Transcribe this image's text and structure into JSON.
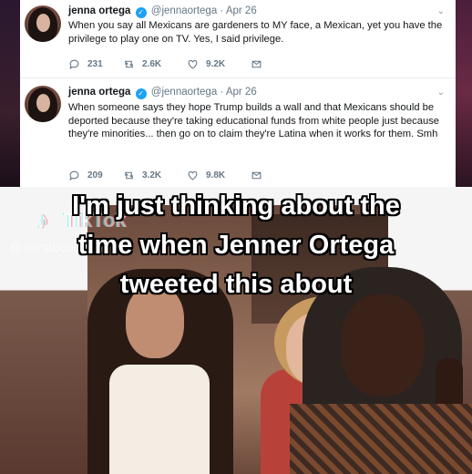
{
  "tweets": [
    {
      "name": "jenna ortega",
      "handle": "@jennaortega",
      "date": "Apr 26",
      "text": "When you say all Mexicans are gardeners to MY face, a Mexican, yet you have the privilege to play one on TV. Yes, I said privilege.",
      "replies": "231",
      "retweets": "2.6K",
      "likes": "9.2K"
    },
    {
      "name": "jenna ortega",
      "handle": "@jennaortega",
      "date": "Apr 26",
      "text": "When someone says they hope Trump builds a wall and that Mexicans should be deported because they're taking educational funds from white people just because they're minorities... then go on to claim they're Latina when it works for them. Smh",
      "replies": "209",
      "retweets": "3.2K",
      "likes": "9.8K"
    }
  ],
  "separator": "·",
  "verified_glyph": "✓",
  "chevron_glyph": "⌄",
  "video": {
    "caption_lines": [
      "I'm just thinking about the",
      "time when Jenner Ortega",
      "tweeted this about"
    ],
    "watermark_logo": "♪",
    "watermark_word": "TikTok",
    "watermark_handle": "@xeinabcoulibaly"
  },
  "icons": {
    "reply": "reply-icon",
    "retweet": "retweet-icon",
    "like": "heart-icon",
    "share": "share-icon"
  },
  "colors": {
    "twitter_blue": "#1da1f2",
    "text_dark": "#14171a",
    "text_gray": "#657786"
  }
}
